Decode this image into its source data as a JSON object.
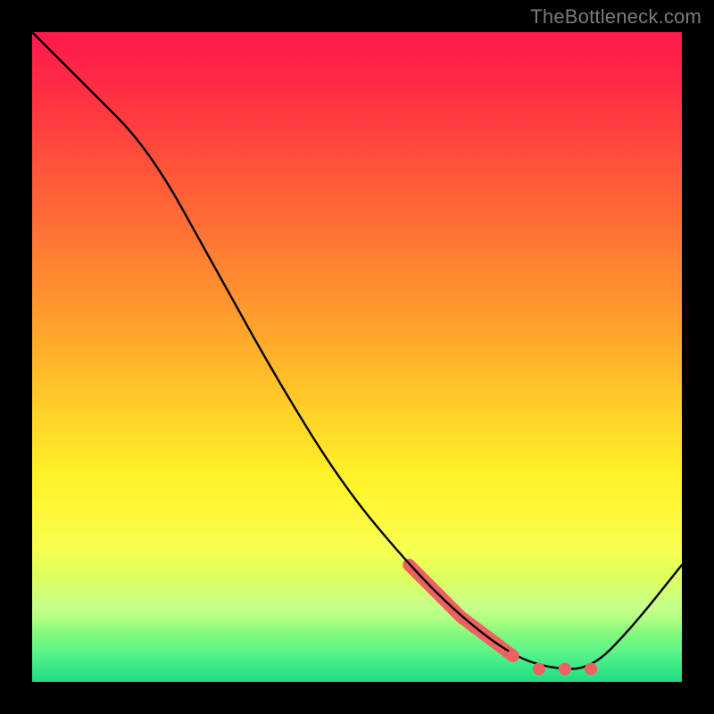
{
  "attribution": "TheBottleneck.com",
  "colors": {
    "highlight": "#f06060",
    "curve": "#000000",
    "gradient_top": "#ff1a4d",
    "gradient_bottom": "#1edc84"
  },
  "chart_data": {
    "type": "line",
    "title": "",
    "xlabel": "",
    "ylabel": "",
    "xlim": [
      0,
      100
    ],
    "ylim": [
      0,
      100
    ],
    "grid": false,
    "legend": false,
    "series": [
      {
        "name": "bottleneck-curve",
        "x": [
          0,
          8,
          18,
          28,
          38,
          48,
          58,
          66,
          74,
          80,
          86,
          92,
          100
        ],
        "y": [
          100,
          92,
          82,
          64,
          46,
          30,
          18,
          10,
          4,
          2,
          2,
          8,
          18
        ]
      }
    ],
    "highlight_segment": {
      "description": "thick salmon segment along main curve",
      "x_start": 58,
      "x_end": 74
    },
    "highlight_points": {
      "description": "salmon dots near curve minimum",
      "points": [
        {
          "x": 74,
          "y": 4
        },
        {
          "x": 78,
          "y": 2
        },
        {
          "x": 82,
          "y": 2
        },
        {
          "x": 86,
          "y": 2
        }
      ]
    }
  }
}
